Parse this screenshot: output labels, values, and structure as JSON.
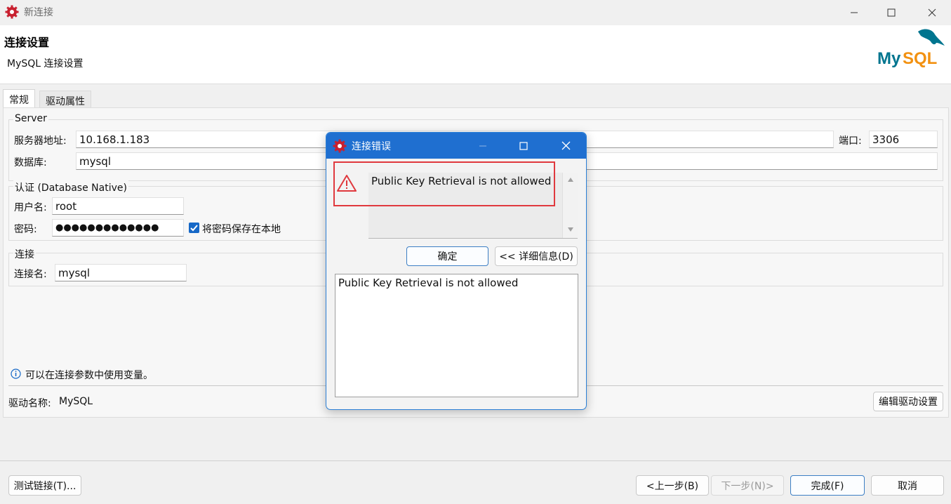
{
  "window": {
    "title": "新连接",
    "header_title": "连接设置",
    "header_subtitle": "MySQL 连接设置",
    "logo_text": "MySQL"
  },
  "tabs": [
    {
      "label": "常规"
    },
    {
      "label": "驱动属性"
    }
  ],
  "server": {
    "group_title": "Server",
    "host_label": "服务器地址:",
    "host_value": "10.168.1.183",
    "port_label": "端口:",
    "port_value": "3306",
    "database_label": "数据库:",
    "database_value": "mysql"
  },
  "auth": {
    "group_title": "认证 (Database Native)",
    "user_label": "用户名:",
    "user_value": "root",
    "password_label": "密码:",
    "password_value": "●●●●●●●●●●●●●",
    "save_password_label": "将密码保存在本地",
    "save_password_checked": true
  },
  "connection": {
    "group_title": "连接",
    "name_label": "连接名:",
    "name_value": "mysql"
  },
  "info_text": "可以在连接参数中使用变量。",
  "driver": {
    "name_label": "驱动名称:",
    "name_value": "MySQL",
    "edit_button": "编辑驱动设置"
  },
  "footer": {
    "test_button": "测试链接(T)...",
    "back_button": "<上一步(B)",
    "next_button": "下一步(N)>",
    "finish_button": "完成(F)",
    "cancel_button": "取消"
  },
  "error_dialog": {
    "title": "连接错误",
    "message": "Public Key Retrieval is not allowed",
    "ok_button": "确定",
    "details_button": "<< 详细信息(D)",
    "details_text": "Public Key Retrieval is not allowed"
  },
  "colors": {
    "accent": "#1f6fd0",
    "error_outline": "#e0393e",
    "logo_teal": "#00758f",
    "logo_orange": "#f29111"
  }
}
